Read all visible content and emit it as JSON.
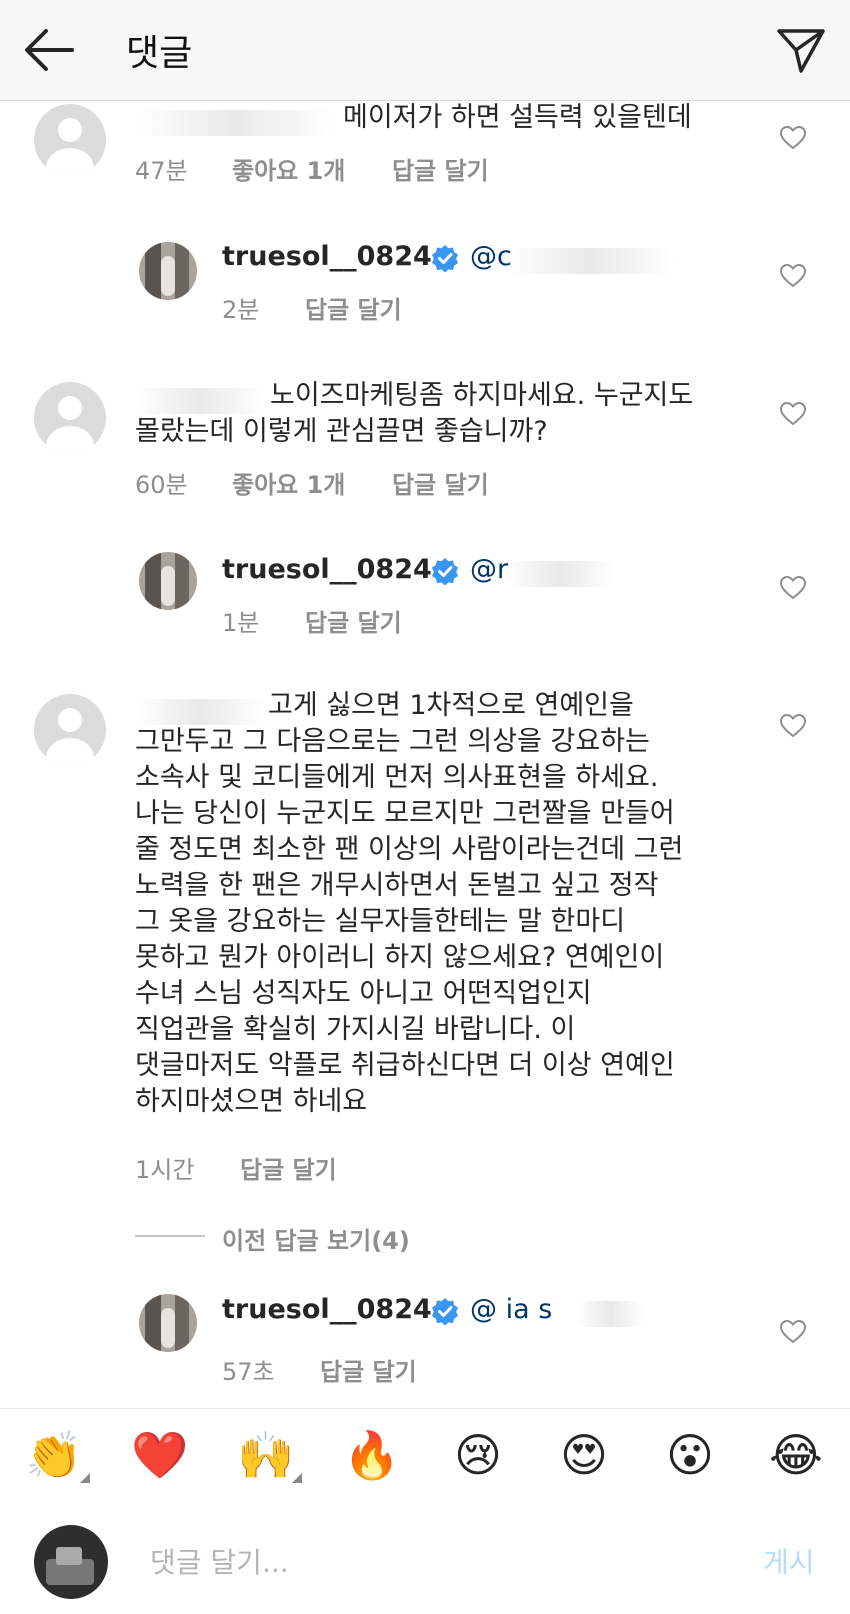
{
  "header": {
    "title": "댓글",
    "back_icon": "arrow-left-icon",
    "share_icon": "paper-plane-icon"
  },
  "comments": [
    {
      "text_lines": [
        "메이저가 하면 설득력 있을텐데"
      ],
      "time": "47분",
      "likes": "좋아요 1개",
      "reply": "답글 달기",
      "reply_item": {
        "username": "truesol__0824",
        "mention": "@c",
        "time": "2분",
        "reply": "답글 달기"
      }
    },
    {
      "text_lines": [
        "노이즈마케팅좀 하지마세요. 누군지도",
        "몰랐는데 이렇게 관심끌면 좋습니까?"
      ],
      "time": "60분",
      "likes": "좋아요 1개",
      "reply": "답글 달기",
      "reply_item": {
        "username": "truesol__0824",
        "mention": "@r",
        "time": "1분",
        "reply": "답글 달기"
      }
    },
    {
      "text_lines": [
        "고게 싫으면 1차적으로 연예인을",
        "그만두고 그 다음으로는 그런 의상을 강요하는",
        "소속사 및 코디들에게 먼저 의사표현을 하세요.",
        "나는 당신이 누군지도 모르지만 그런짤을 만들어",
        "줄 정도면 최소한 팬 이상의 사람이라는건데 그런",
        "노력을 한 팬은 개무시하면서 돈벌고 싶고 정작",
        "그 옷을 강요하는 실무자들한테는 말 한마디",
        "못하고 뭔가 아이러니 하지 않으세요? 연예인이",
        "수녀 스님 성직자도 아니고 어떤직업인지",
        "직업관을 확실히 가지시길 바랍니다. 이",
        "댓글마저도 악플로 취급하신다면 더 이상 연예인",
        "하지마셨으면 하네요"
      ],
      "time": "1시간",
      "reply": "답글 달기",
      "view_previous": "이전 답글 보기(4)",
      "reply_item": {
        "username": "truesol__0824",
        "mention": "@ ia s",
        "time": "57초",
        "reply": "답글 달기"
      }
    }
  ],
  "reactions": [
    "👏",
    "❤️",
    "🙌",
    "🔥",
    "😢",
    "😍",
    "😮",
    "😂"
  ],
  "composer": {
    "placeholder": "댓글 달기...",
    "post_label": "게시"
  }
}
